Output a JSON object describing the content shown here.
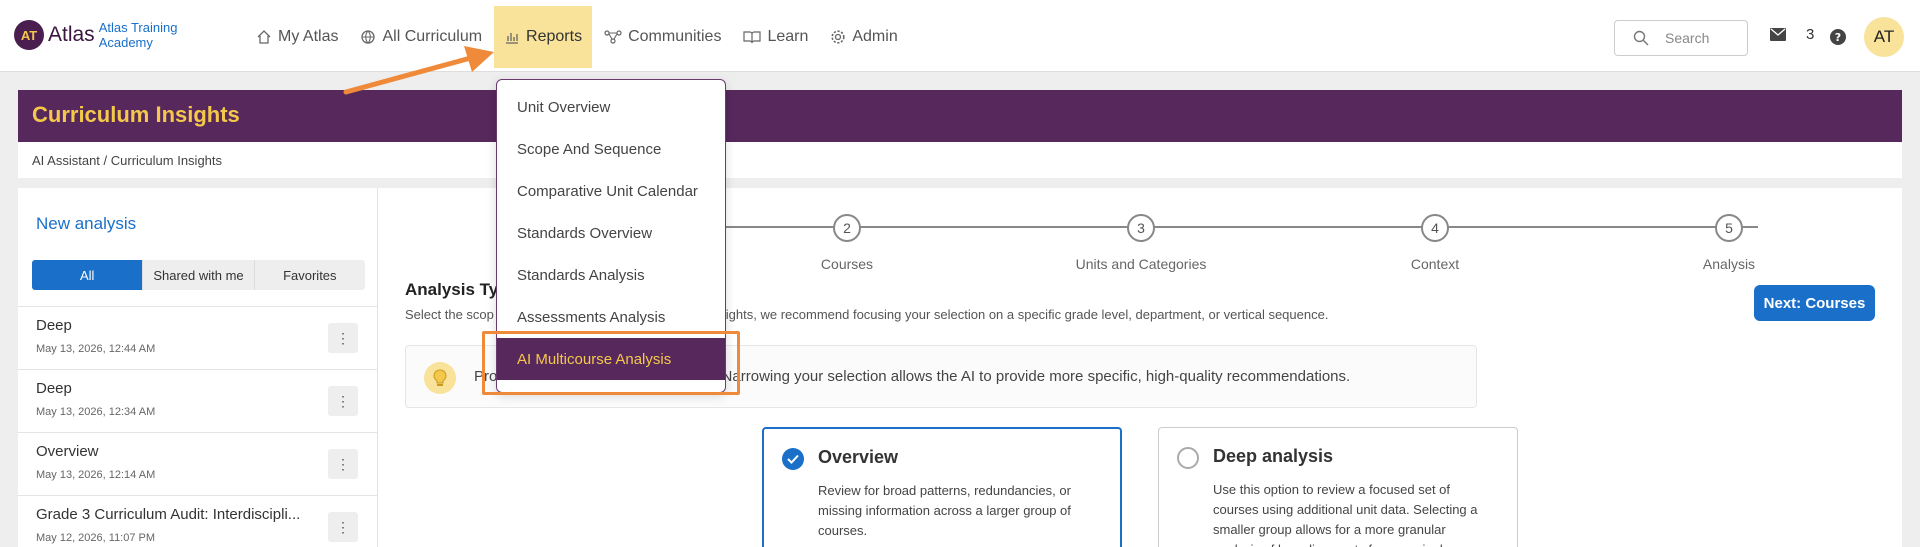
{
  "header": {
    "logo_mark": "AT",
    "logo_text": "Atlas",
    "logo_sub": "Atlas Training Academy",
    "nav": [
      "My Atlas",
      "All Curriculum",
      "Reports",
      "Communities",
      "Learn",
      "Admin"
    ],
    "search_placeholder": "Search",
    "notification_count": "3",
    "avatar_initials": "AT"
  },
  "banner": {
    "title": "Curriculum Insights"
  },
  "breadcrumb": "AI Assistant / Curriculum Insights",
  "sidebar": {
    "new_analysis": "New analysis",
    "filters": [
      "All",
      "Shared with me",
      "Favorites"
    ],
    "items": [
      {
        "title": "Deep",
        "date": "May 13, 2026, 12:44 AM"
      },
      {
        "title": "Deep",
        "date": "May 13, 2026, 12:34 AM"
      },
      {
        "title": "Overview",
        "date": "May 13, 2026, 12:14 AM"
      },
      {
        "title": "Grade 3 Curriculum Audit: Interdiscipli...",
        "date": "May 12, 2026, 11:07 PM"
      }
    ],
    "kebab": "⋮"
  },
  "steps": [
    {
      "num": "2",
      "label": "Courses"
    },
    {
      "num": "3",
      "label": "Units and Categories"
    },
    {
      "num": "4",
      "label": "Context"
    },
    {
      "num": "5",
      "label": "Analysis"
    }
  ],
  "main": {
    "analysis_title": "Analysis Typ",
    "analysis_desc": "Select the scop                                              tionable insights, we recommend focusing your selection on a specific grade level, department, or vertical sequence.",
    "next_button": "Next: Courses",
    "tip": "Pro                                    ter results. Narrowing your selection allows the AI to provide more specific, high-quality recommendations.",
    "options": [
      {
        "title": "Overview",
        "desc": "Review for broad patterns, redundancies, or missing information across a larger group of courses.",
        "selected": true
      },
      {
        "title": "Deep analysis",
        "desc": "Use this option to review a focused set of courses using additional unit data. Selecting a smaller group allows for a more granular analysis of key alignments for your single",
        "selected": false
      }
    ]
  },
  "reports_menu": [
    "Unit Overview",
    "Scope And Sequence",
    "Comparative Unit Calendar",
    "Standards Overview",
    "Standards Analysis",
    "Assessments Analysis",
    "AI Multicourse Analysis"
  ],
  "colors": {
    "brand": "#57285c",
    "accent": "#f4c84a",
    "link": "#1a6fc9",
    "annotation": "#ef8a3a"
  }
}
